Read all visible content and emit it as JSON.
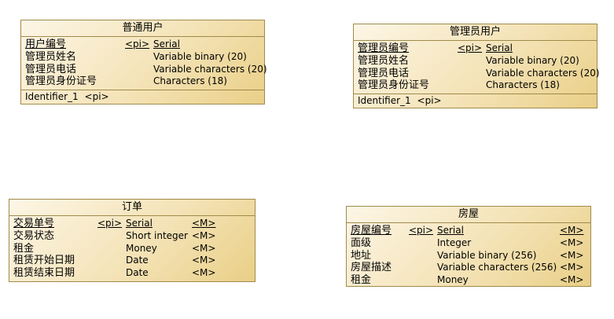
{
  "entities": {
    "user": {
      "title": "普通用户",
      "attrs": [
        {
          "name": "用户编号",
          "key": "<pi>",
          "type": "Serial"
        },
        {
          "name": "管理员姓名",
          "type": "Variable binary (20)"
        },
        {
          "name": "管理员电话",
          "type": "Variable characters (20)"
        },
        {
          "name": "管理员身份证号",
          "type": "Characters (18)"
        }
      ],
      "identifier": "Identifier_1",
      "identifier_key": "<pi>"
    },
    "admin": {
      "title": "管理员用户",
      "attrs": [
        {
          "name": "管理员编号",
          "key": "<pi>",
          "type": "Serial"
        },
        {
          "name": "管理员姓名",
          "type": "Variable binary (20)"
        },
        {
          "name": "管理员电话",
          "type": "Variable characters (20)"
        },
        {
          "name": "管理员身份证号",
          "type": "Characters (18)"
        }
      ],
      "identifier": "Identifier_1",
      "identifier_key": "<pi>"
    },
    "order": {
      "title": "订单",
      "attrs": [
        {
          "name": "交易单号",
          "key": "<pi>",
          "type": "Serial",
          "mand": "<M>"
        },
        {
          "name": "交易状态",
          "type": "Short integer",
          "mand": "<M>"
        },
        {
          "name": "租金",
          "type": "Money",
          "mand": "<M>"
        },
        {
          "name": "租赁开始日期",
          "type": "Date",
          "mand": "<M>"
        },
        {
          "name": "租赁结束日期",
          "type": "Date",
          "mand": "<M>"
        }
      ]
    },
    "house": {
      "title": "房屋",
      "attrs": [
        {
          "name": "房屋编号",
          "key": "<pi>",
          "type": "Serial",
          "mand": "<M>"
        },
        {
          "name": "面级",
          "type": "Integer",
          "mand": "<M>"
        },
        {
          "name": "地址",
          "type": "Variable binary (256)",
          "mand": "<M>"
        },
        {
          "name": "房屋描述",
          "type": "Variable characters (256)",
          "mand": "<M>"
        },
        {
          "name": "租金",
          "type": "Money",
          "mand": "<M>"
        }
      ]
    }
  }
}
